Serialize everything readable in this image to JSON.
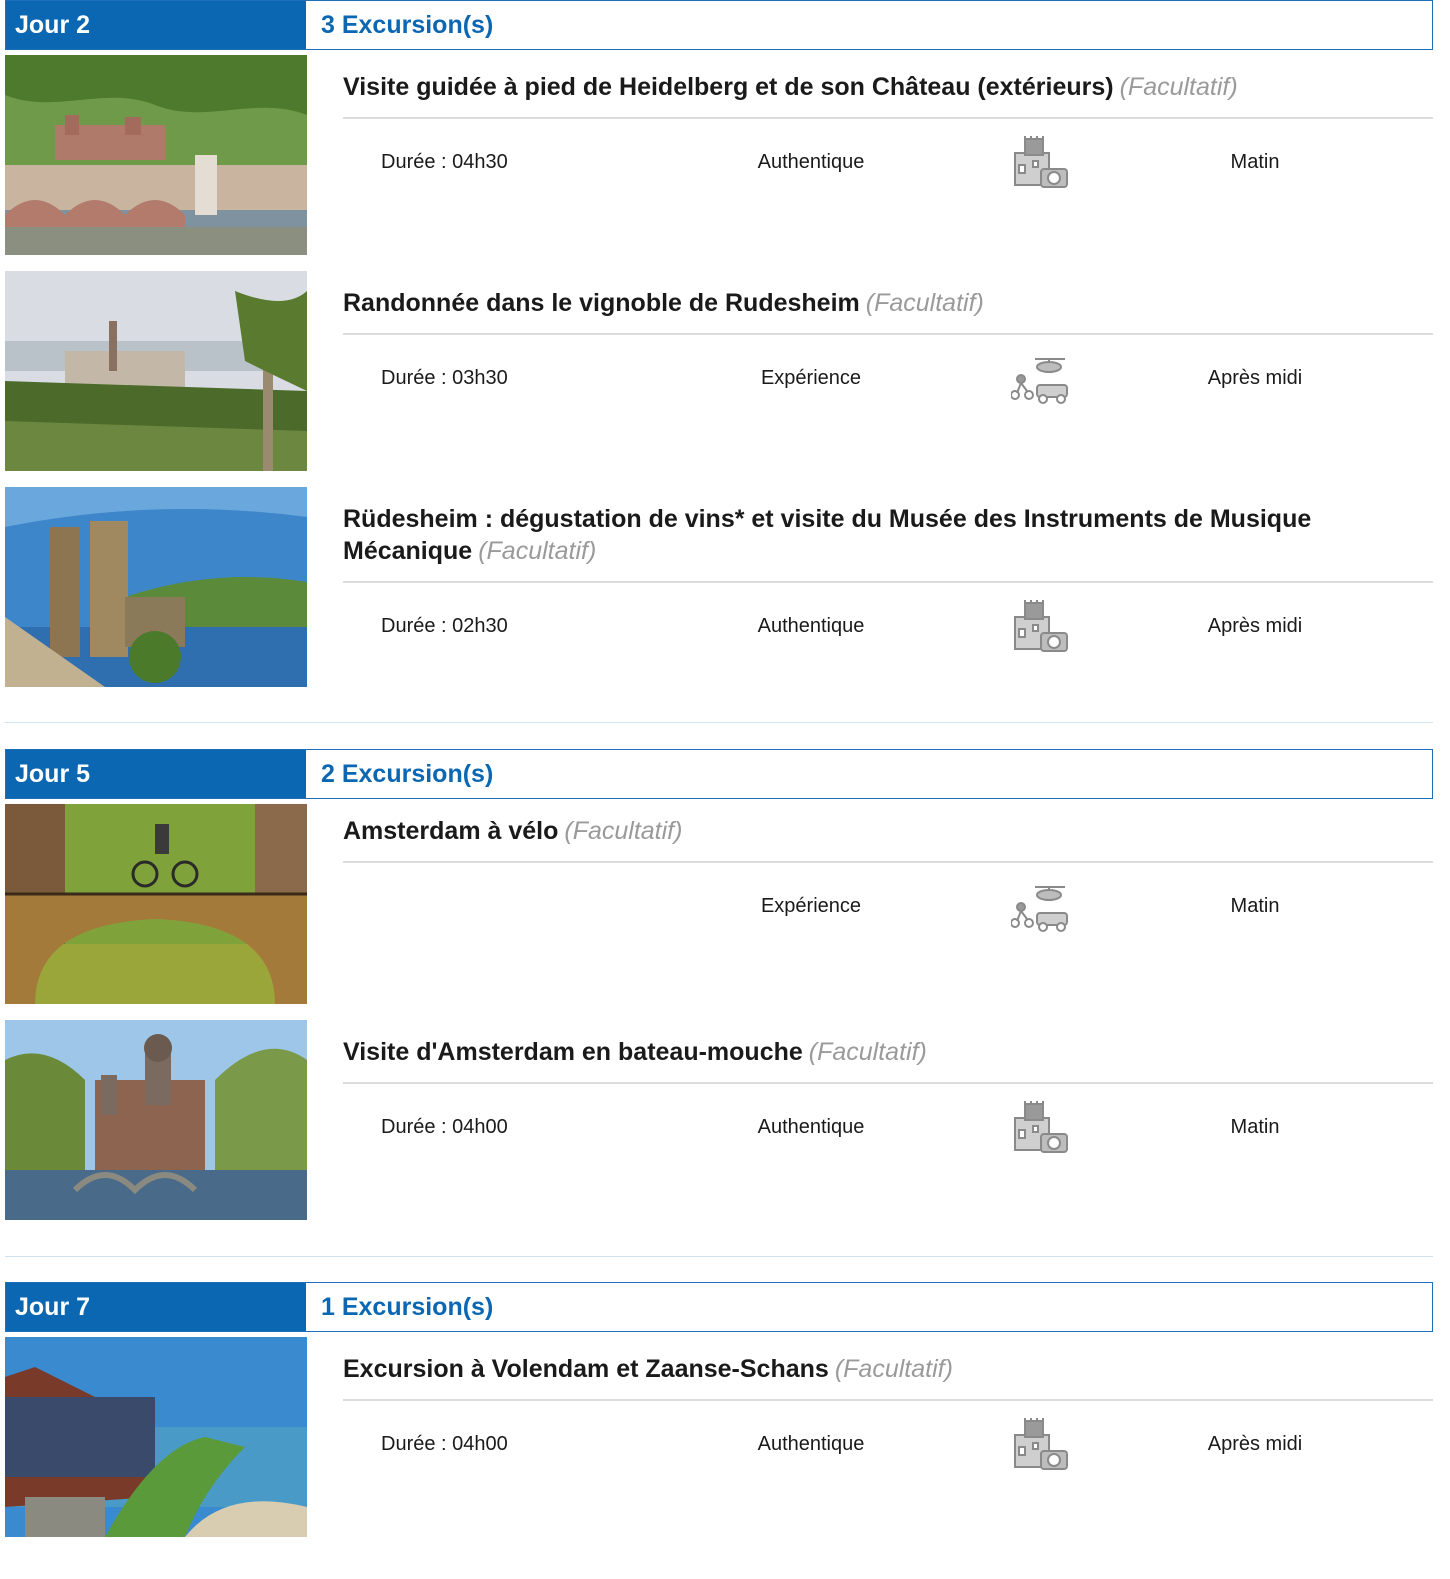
{
  "days": [
    {
      "label": "Jour 2",
      "count": "3 Excursion(s)",
      "excursions": [
        {
          "title": "Visite guidée à pied de Heidelberg et de son Château (extérieurs)",
          "optional": "(Facultatif)",
          "duration": "Durée : 04h30",
          "type": "Authentique",
          "icon": "castle-camera-icon",
          "time": "Matin",
          "image": "heidelberg-castle-photo"
        },
        {
          "title": "Randonnée dans le vignoble de Rudesheim",
          "optional": "(Facultatif)",
          "duration": "Durée : 03h30",
          "type": "Expérience",
          "icon": "activity-vehicles-icon",
          "time": "Après midi",
          "image": "rudesheim-vineyard-photo"
        },
        {
          "title": "Rüdesheim : dégustation de vins* et visite du Musée des Instruments de Musique Mécanique",
          "optional": "(Facultatif)",
          "duration": "Durée : 02h30",
          "type": "Authentique",
          "icon": "castle-camera-icon",
          "time": "Après midi",
          "image": "rhine-tower-photo"
        }
      ]
    },
    {
      "label": "Jour 5",
      "count": "2 Excursion(s)",
      "excursions": [
        {
          "title": "Amsterdam à vélo",
          "optional": "(Facultatif)",
          "duration": "",
          "type": "Expérience",
          "icon": "activity-vehicles-icon",
          "time": "Matin",
          "image": "amsterdam-bridge-cyclist-photo"
        },
        {
          "title": "Visite d'Amsterdam en bateau-mouche",
          "optional": "(Facultatif)",
          "duration": "Durée : 04h00",
          "type": "Authentique",
          "icon": "castle-camera-icon",
          "time": "Matin",
          "image": "amsterdam-canal-church-photo"
        }
      ]
    },
    {
      "label": "Jour 7",
      "count": "1 Excursion(s)",
      "excursions": [
        {
          "title": "Excursion à Volendam et Zaanse-Schans",
          "optional": "(Facultatif)",
          "duration": "Durée : 04h00",
          "type": "Authentique",
          "icon": "castle-camera-icon",
          "time": "Après midi",
          "image": "volendam-harbour-photo"
        }
      ]
    }
  ],
  "colors": {
    "accent": "#0b67b2",
    "optional_text": "#9a9a9a",
    "divider": "#dcdcdc",
    "icon_gray": "#8a8a8a"
  }
}
